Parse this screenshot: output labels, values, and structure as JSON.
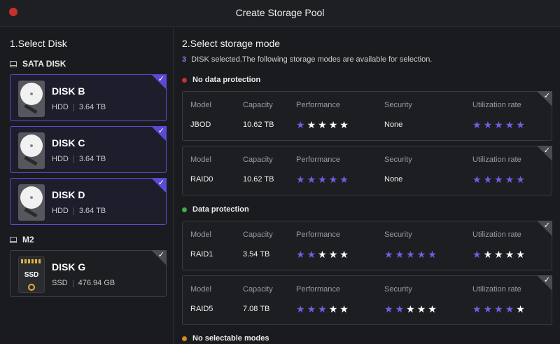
{
  "window": {
    "title": "Create Storage Pool"
  },
  "left": {
    "heading": "1.Select Disk",
    "groups": [
      {
        "label": "SATA DISK"
      },
      {
        "label": "M2"
      }
    ],
    "disks": [
      {
        "name": "DISK B",
        "type": "HDD",
        "size": "3.64 TB",
        "selected": true
      },
      {
        "name": "DISK C",
        "type": "HDD",
        "size": "3.64 TB",
        "selected": true
      },
      {
        "name": "DISK D",
        "type": "HDD",
        "size": "3.64 TB",
        "selected": true
      },
      {
        "name": "DISK G",
        "type": "SSD",
        "size": "476.94 GB",
        "selected": false
      }
    ],
    "ssd_icon_label": "SSD"
  },
  "right": {
    "heading": "2.Select storage mode",
    "selected_count": "3",
    "info_text": "DISK selected.The following storage modes are available for selection.",
    "sections": [
      {
        "label": "No data protection",
        "color": "#c8302e"
      },
      {
        "label": "Data protection",
        "color": "#3fae49"
      },
      {
        "label": "No selectable modes",
        "color": "#d98a1f"
      }
    ],
    "columns": {
      "model": "Model",
      "capacity": "Capacity",
      "performance": "Performance",
      "security": "Security",
      "utilization": "Utilization rate"
    },
    "modes": [
      {
        "model": "JBOD",
        "capacity": "10.62 TB",
        "performance": 1,
        "security_text": "None",
        "security": null,
        "utilization": 5
      },
      {
        "model": "RAID0",
        "capacity": "10.62 TB",
        "performance": 5,
        "security_text": "None",
        "security": null,
        "utilization": 5
      },
      {
        "model": "RAID1",
        "capacity": "3.54 TB",
        "performance": 2,
        "security_text": null,
        "security": 5,
        "utilization": 1
      },
      {
        "model": "RAID5",
        "capacity": "7.08 TB",
        "performance": 3,
        "security_text": null,
        "security": 2,
        "utilization": 4
      }
    ],
    "star_max": 5
  },
  "colors": {
    "accent": "#6e5fe6",
    "selected_border": "#5a4bd6"
  },
  "icons": {
    "close": "close-dot-icon",
    "disk_group": "drive-icon",
    "hdd": "hdd-icon",
    "ssd": "ssd-icon",
    "check": "check-icon",
    "star": "star-icon"
  }
}
